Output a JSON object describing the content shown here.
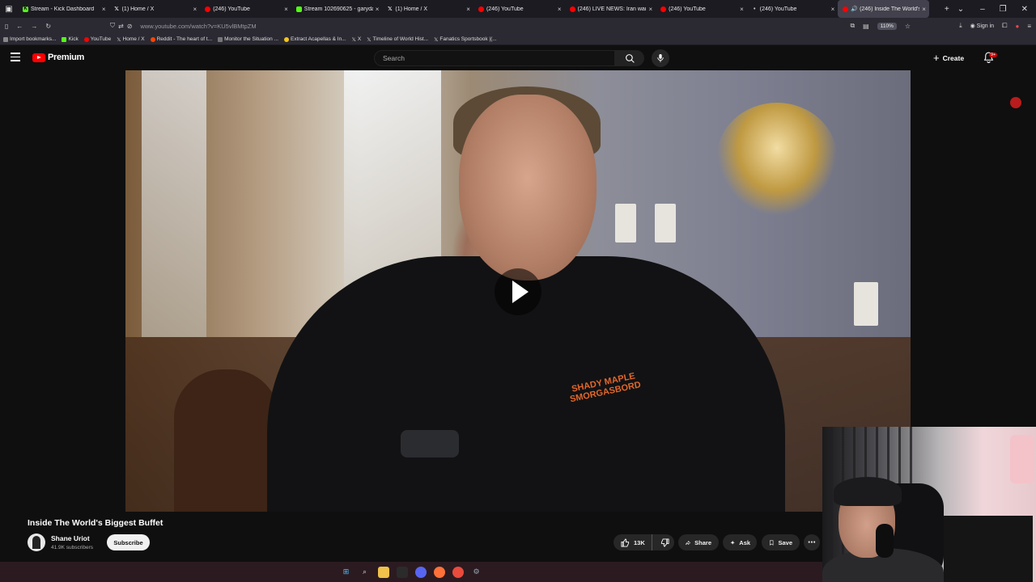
{
  "browser": {
    "tabs": [
      {
        "title": "Stream - Kick Dashboard",
        "favicon": "kick-icon",
        "active": false
      },
      {
        "title": "(1) Home / X",
        "favicon": "x-icon",
        "active": false
      },
      {
        "title": "(246) YouTube",
        "favicon": "youtube-icon",
        "active": false
      },
      {
        "title": "Stream 102690625 - garydavid",
        "favicon": "kick-icon",
        "active": false
      },
      {
        "title": "(1) Home / X",
        "favicon": "x-icon",
        "active": false
      },
      {
        "title": "(246) YouTube",
        "favicon": "youtube-icon",
        "active": false
      },
      {
        "title": "(246) LIVE NEWS: Iran war latest",
        "favicon": "youtube-icon",
        "active": false
      },
      {
        "title": "(246) YouTube",
        "favicon": "youtube-icon",
        "active": false
      },
      {
        "title": "(246) YouTube",
        "favicon": "youtube-icon",
        "active": false
      },
      {
        "title": "(246) Inside The World's Bi",
        "favicon": "youtube-icon",
        "active": true
      }
    ],
    "url": "www.youtube.com/watch?v=KU5vlBMtpZM",
    "zoom": "110%",
    "sign_in": "Sign in",
    "bookmarks": [
      {
        "label": "Import bookmarks...",
        "icon": "import-icon"
      },
      {
        "label": "Kick",
        "icon": "kick-icon"
      },
      {
        "label": "YouTube",
        "icon": "youtube-icon"
      },
      {
        "label": "Home / X",
        "icon": "x-icon"
      },
      {
        "label": "Reddit - The heart of t...",
        "icon": "reddit-icon"
      },
      {
        "label": "Monitor the Situation ...",
        "icon": "monitor-icon"
      },
      {
        "label": "Extract Acapellas & In...",
        "icon": "smiley-icon"
      },
      {
        "label": "X",
        "icon": "x-icon"
      },
      {
        "label": "Timeline of World Hist...",
        "icon": "x-icon"
      },
      {
        "label": "Fanatics Sportsbook |(...",
        "icon": "x-icon"
      }
    ]
  },
  "youtube": {
    "brand": "Premium",
    "search_placeholder": "Search",
    "create_label": "Create",
    "notification_count": "9+"
  },
  "video": {
    "title": "Inside The World's Biggest Buffet",
    "shirt_logo_text": "SHADY MAPLE SMORGASBORD",
    "channel_name": "Shane Uriot",
    "subscribers": "41.9K subscribers",
    "subscribe_label": "Subscribe",
    "likes": "13K",
    "share_label": "Share",
    "ask_label": "Ask",
    "save_label": "Save"
  },
  "colors": {
    "youtube_red": "#ff0000",
    "background": "#0f0f0f",
    "pill": "#272727"
  }
}
